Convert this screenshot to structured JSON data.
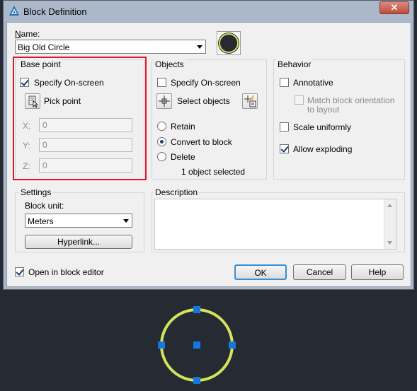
{
  "window": {
    "title": "Block Definition",
    "close_label": "✕"
  },
  "name": {
    "label": "Name:",
    "value": "Big Old Circle"
  },
  "base_point": {
    "group_label": "Base point",
    "specify_label": "Specify On-screen",
    "specify_checked": true,
    "pick_label": "Pick point",
    "x_label": "X:",
    "x_value": "0",
    "y_label": "Y:",
    "y_value": "0",
    "z_label": "Z:",
    "z_value": "0"
  },
  "objects": {
    "group_label": "Objects",
    "specify_label": "Specify On-screen",
    "specify_checked": false,
    "select_label": "Select objects",
    "retain_label": "Retain",
    "convert_label": "Convert to block",
    "delete_label": "Delete",
    "status": "1 object selected",
    "selected_option": "convert"
  },
  "behavior": {
    "group_label": "Behavior",
    "annotative_label": "Annotative",
    "annotative_checked": false,
    "match_label": "Match block orientation",
    "match_label2": "to layout",
    "scale_label": "Scale uniformly",
    "scale_checked": false,
    "explode_label": "Allow exploding",
    "explode_checked": true
  },
  "settings": {
    "group_label": "Settings",
    "unit_label": "Block unit:",
    "unit_value": "Meters",
    "hyperlink_label": "Hyperlink..."
  },
  "description": {
    "group_label": "Description",
    "value": ""
  },
  "footer": {
    "open_editor_label": "Open in block editor",
    "open_editor_checked": true,
    "ok_label": "OK",
    "cancel_label": "Cancel",
    "help_label": "Help"
  },
  "colors": {
    "canvas_bg": "#262a33",
    "circle_stroke": "#d5e35a",
    "grip_blue": "#1478e0",
    "highlight_red": "#e0142a"
  }
}
